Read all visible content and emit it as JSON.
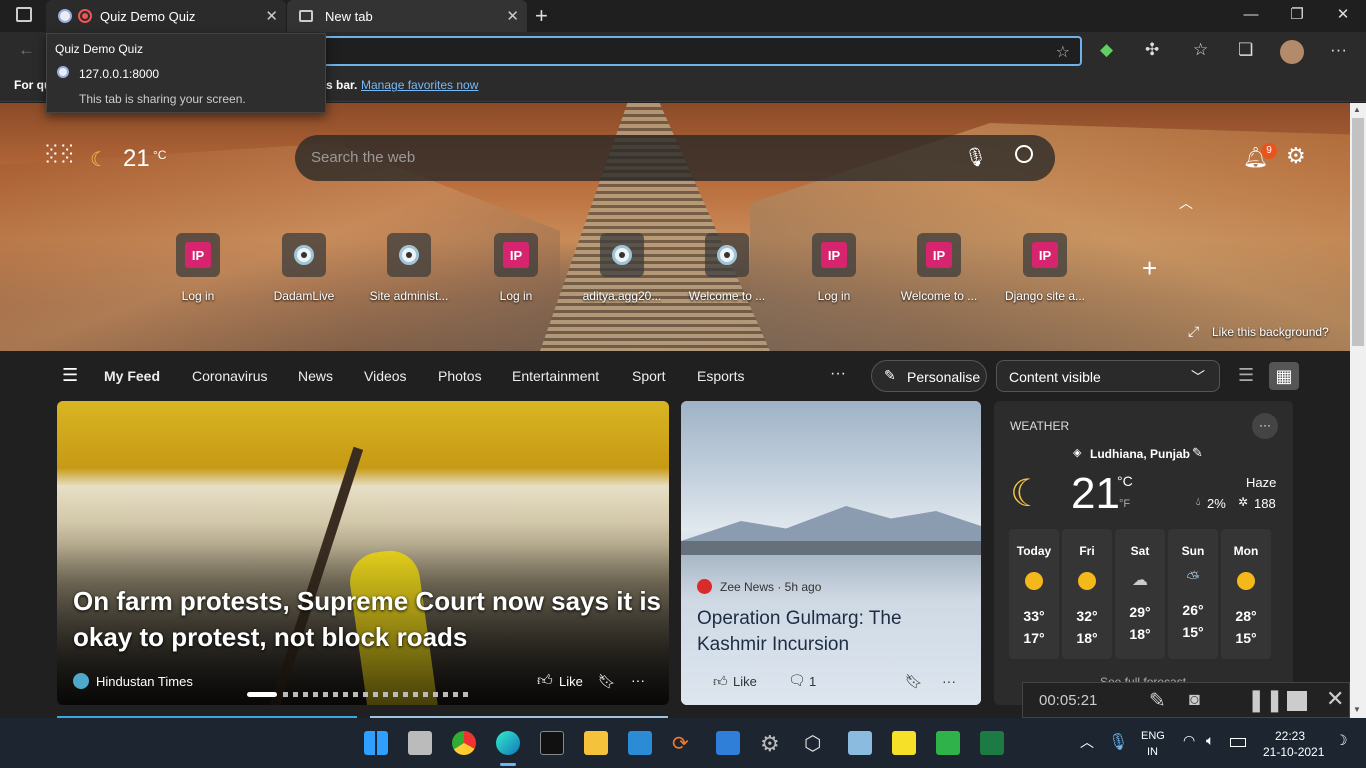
{
  "browser": {
    "tabs": [
      {
        "title": "Quiz Demo Quiz",
        "active": false
      },
      {
        "title": "New tab",
        "active": true
      }
    ],
    "tooltip": {
      "title": "Quiz Demo Quiz",
      "url": "127.0.0.1:8000",
      "note": "This tab is sharing your screen."
    },
    "favbar": {
      "prefix": "For qu",
      "suffix": "s bar.",
      "link": "Manage favorites now"
    }
  },
  "header": {
    "temperature": "21",
    "unit": "°C",
    "search_placeholder": "Search the web",
    "notification_count": "9"
  },
  "quick_links": [
    {
      "label": "Log in",
      "icon": "IP"
    },
    {
      "label": "DadamLive",
      "icon": "globe"
    },
    {
      "label": "Site administ...",
      "icon": "globe"
    },
    {
      "label": "Log in",
      "icon": "IP"
    },
    {
      "label": "aditya.agg20...",
      "icon": "globe"
    },
    {
      "label": "Welcome to ...",
      "icon": "globe"
    },
    {
      "label": "Log in",
      "icon": "IP"
    },
    {
      "label": "Welcome to ...",
      "icon": "IP"
    },
    {
      "label": "Django site a...",
      "icon": "IP"
    }
  ],
  "background_link": "Like this background?",
  "feed_nav": {
    "items": [
      "My Feed",
      "Coronavirus",
      "News",
      "Videos",
      "Photos",
      "Entertainment",
      "Sport",
      "Esports"
    ],
    "more": "···",
    "personalise": "Personalise",
    "content_select": "Content visible"
  },
  "main_story": {
    "title": "On farm protests, Supreme Court now says it is okay to protest, not block roads",
    "source": "Hindustan Times",
    "like": "Like",
    "more": "···"
  },
  "second_story": {
    "source": "Zee News · 5h ago",
    "title": "Operation Gulmarg: The Kashmir Incursion",
    "like": "Like",
    "comments": "1",
    "more": "···"
  },
  "weather": {
    "heading": "WEATHER",
    "location": "Ludhiana, Punjab",
    "temp": "21",
    "unit_c": "°C",
    "unit_f": "°F",
    "condition": "Haze",
    "precip": "2%",
    "aqi": "188",
    "more": "···",
    "forecast": [
      {
        "day": "Today",
        "high": "33°",
        "low": "17°"
      },
      {
        "day": "Fri",
        "high": "32°",
        "low": "18°"
      },
      {
        "day": "Sat",
        "high": "29°",
        "low": "18°"
      },
      {
        "day": "Sun",
        "high": "26°",
        "low": "15°"
      },
      {
        "day": "Mon",
        "high": "28°",
        "low": "15°"
      }
    ],
    "see_full": "See full forecast"
  },
  "recorder": {
    "time": "00:05:21"
  },
  "taskbar": {
    "lang": "ENG",
    "region": "IN",
    "time": "22:23",
    "date": "21-10-2021"
  }
}
